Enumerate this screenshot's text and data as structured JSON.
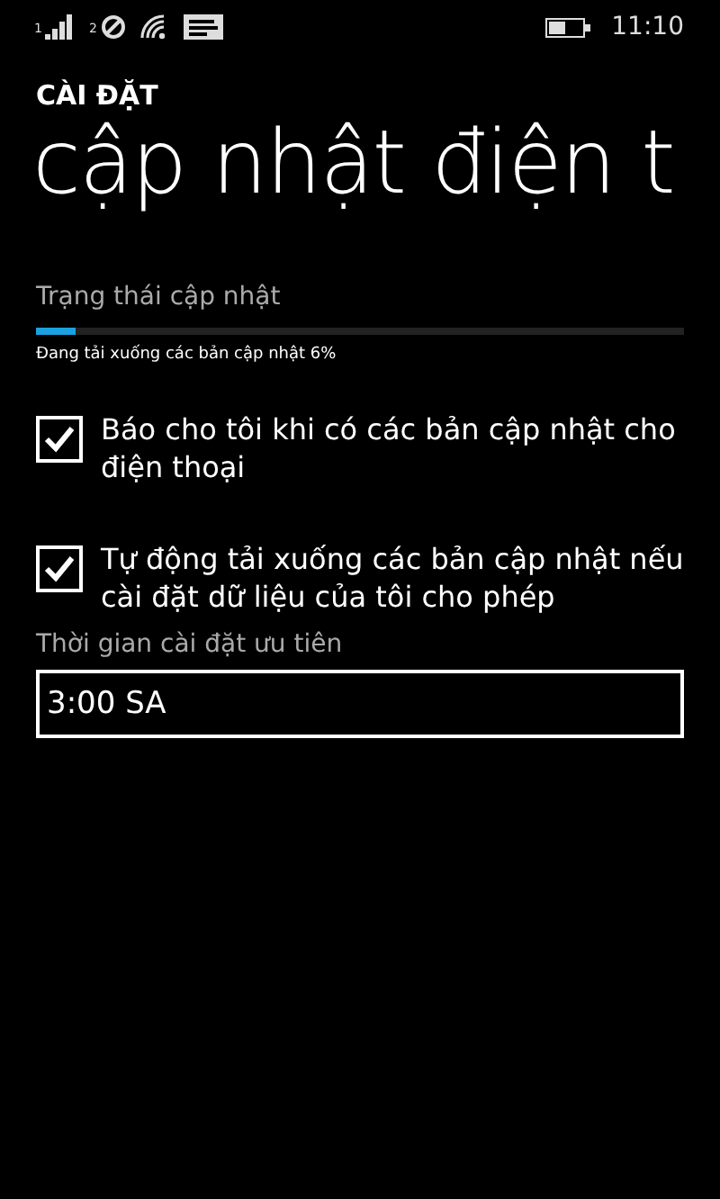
{
  "status_bar": {
    "sim1_label": "1",
    "sim2_label": "2",
    "time": "11:10"
  },
  "header": {
    "app_title": "CÀI ĐẶT",
    "page_title": "cập nhật điện t"
  },
  "update_status": {
    "label": "Trạng thái cập nhật",
    "level": 0.06,
    "message": "Đang tải xuống các bản cập nhật 6%"
  },
  "options": [
    {
      "label": "Báo cho tôi khi có các bản cập nhật cho điện thoại",
      "checked": true
    },
    {
      "label": "Tự động tải xuống các bản cập nhật nếu cài đặt dữ liệu của tôi cho phép",
      "checked": true
    }
  ],
  "install_time": {
    "label": "Thời gian cài đặt ưu tiên",
    "value": "3:00 SA"
  }
}
